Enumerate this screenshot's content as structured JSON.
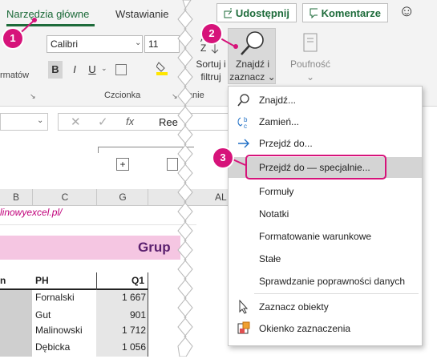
{
  "ribbon": {
    "tabs": [
      "Narzędzia główne",
      "Wstawianie"
    ],
    "share_label": "Udostępnij",
    "comments_label": "Komentarze",
    "smiley": "☺",
    "font_name": "Calibri",
    "font_size": "11",
    "bold": "B",
    "italic": "I",
    "underline": "U",
    "group_font": "Czcionka",
    "group_left_fragment": "rmatów",
    "group_mid_fragment": "wanie",
    "sort_label_1": "Sortuj i",
    "sort_label_2": "filtruj",
    "find_label_1": "Znajdź i",
    "find_label_2": "zaznacz",
    "privacy_label": "Poufność"
  },
  "formula_bar": {
    "fx": "fx",
    "value": "Ree"
  },
  "grid": {
    "columns": [
      "B",
      "C",
      "G",
      "AL"
    ],
    "url_fragment": "linowyexcel.pl/",
    "heading_fragment": "Grup",
    "col_header_left": "n",
    "col_header_ph": "PH",
    "col_header_q1": "Q1",
    "rows": [
      {
        "ph": "Fornalski",
        "q1": "1 667"
      },
      {
        "ph": "Gut",
        "q1": "901"
      },
      {
        "ph": "Malinowski",
        "q1": "1 712"
      },
      {
        "ph": "Dębicka",
        "q1": "1 056"
      }
    ]
  },
  "menu": {
    "items": [
      {
        "label": "Znajdź...",
        "icon": "search-icon"
      },
      {
        "label": "Zamień...",
        "icon": "replace-icon"
      },
      {
        "label": "Przejdź do...",
        "icon": "arrow-right-icon"
      },
      {
        "label": "Przejdź do — specjalnie...",
        "icon": "none"
      },
      {
        "label": "Formuły",
        "icon": "none"
      },
      {
        "label": "Notatki",
        "icon": "none"
      },
      {
        "label": "Formatowanie warunkowe",
        "icon": "none"
      },
      {
        "label": "Stałe",
        "icon": "none"
      },
      {
        "label": "Sprawdzanie poprawności danych",
        "icon": "none"
      },
      {
        "label": "Zaznacz obiekty",
        "icon": "cursor-icon"
      },
      {
        "label": "Okienko zaznaczenia",
        "icon": "selection-pane-icon"
      }
    ],
    "highlighted_index": 3
  },
  "badges": [
    "1",
    "2",
    "3"
  ],
  "colors": {
    "accent": "#1d6b3a",
    "badge": "#d6137a",
    "link": "#c0007a",
    "heading_fill": "#f5c6e2"
  }
}
